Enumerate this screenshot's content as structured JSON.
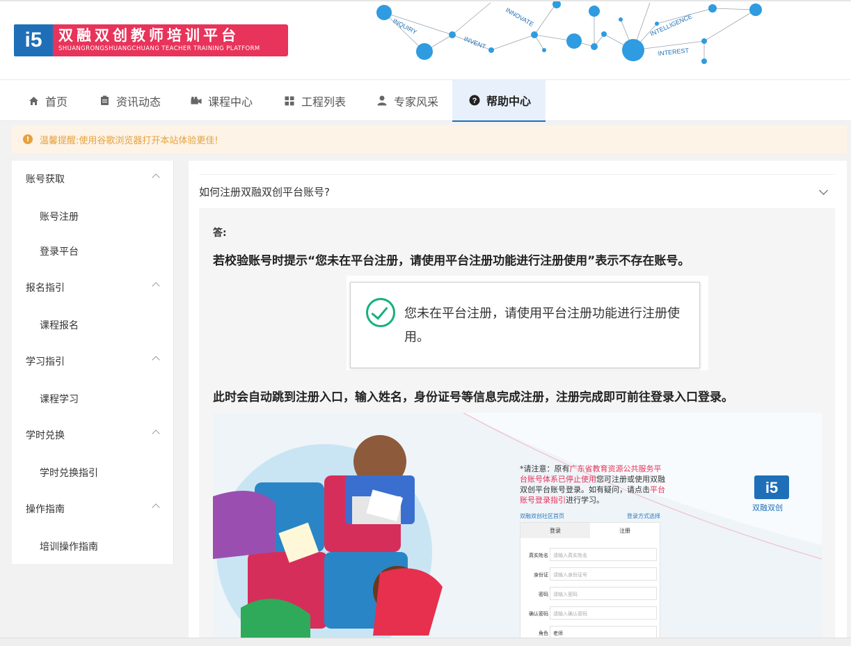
{
  "logo": {
    "mark": "i5",
    "title_cn": "双融双创教师培训平台",
    "title_en": "SHUANGRONGSHUANGCHUANG TEACHER TRAINING PLATFORM"
  },
  "banner": {
    "words": [
      "INQUIRY",
      "INVENT",
      "INNOVATE",
      "INTELLIGENCE",
      "INTEREST"
    ]
  },
  "nav": {
    "items": [
      {
        "label": "首页",
        "icon": "home-icon"
      },
      {
        "label": "资讯动态",
        "icon": "news-icon"
      },
      {
        "label": "课程中心",
        "icon": "camera-icon"
      },
      {
        "label": "工程列表",
        "icon": "grid-icon"
      },
      {
        "label": "专家风采",
        "icon": "user-icon"
      },
      {
        "label": "帮助中心",
        "icon": "help-icon",
        "active": true
      }
    ]
  },
  "notice": {
    "text": "温馨提醒:使用谷歌浏览器打开本站体验更佳!"
  },
  "sidebar": {
    "groups": [
      {
        "label": "账号获取",
        "items": [
          "账号注册",
          "登录平台"
        ]
      },
      {
        "label": "报名指引",
        "items": [
          "课程报名"
        ]
      },
      {
        "label": "学习指引",
        "items": [
          "课程学习"
        ]
      },
      {
        "label": "学时兑换",
        "items": [
          "学时兑换指引"
        ]
      },
      {
        "label": "操作指南",
        "items": [
          "培训操作指南"
        ]
      }
    ]
  },
  "faq": {
    "question": "如何注册双融双创平台账号?",
    "answer_label": "答:",
    "para1": "若校验账号时提示“您未在平台注册，请使用平台注册功能进行注册使用”表示不存在账号。",
    "dialog_msg": "您未在平台注册，请使用平台注册功能进行注册使用。",
    "para2": "此时会自动跳到注册入口，输入姓名，身份证号等信息完成注册，注册完成即可前往登录入口登录。"
  },
  "reg_screenshot": {
    "note_prefix": "*请注意：原有",
    "note_red1": "广东省教育资源公共服务平台账号体系已停止使用",
    "note_mid": "您可注册或使用双融双创平台账号登录。如有疑问，请点击",
    "note_red2": "平台账号登录指引",
    "note_suffix": "进行学习。",
    "link_left": "双融双创社区首页",
    "link_right": "登录方式选择",
    "tab_login": "登录",
    "tab_register": "注册",
    "fields": [
      {
        "label": "真实姓名",
        "placeholder": "请输入真实姓名"
      },
      {
        "label": "身份证",
        "placeholder": "请输入身份证号"
      },
      {
        "label": "密码",
        "placeholder": "请输入密码"
      },
      {
        "label": "确认密码",
        "placeholder": "请输入确认密码"
      },
      {
        "label": "角色",
        "placeholder": "老师"
      }
    ],
    "brand_text": "双融双创",
    "brand_mark": "i5"
  },
  "colors": {
    "brand_blue": "#1e6fb8",
    "brand_red": "#e8335a",
    "warning": "#e6a23c",
    "success": "#16b07a"
  }
}
